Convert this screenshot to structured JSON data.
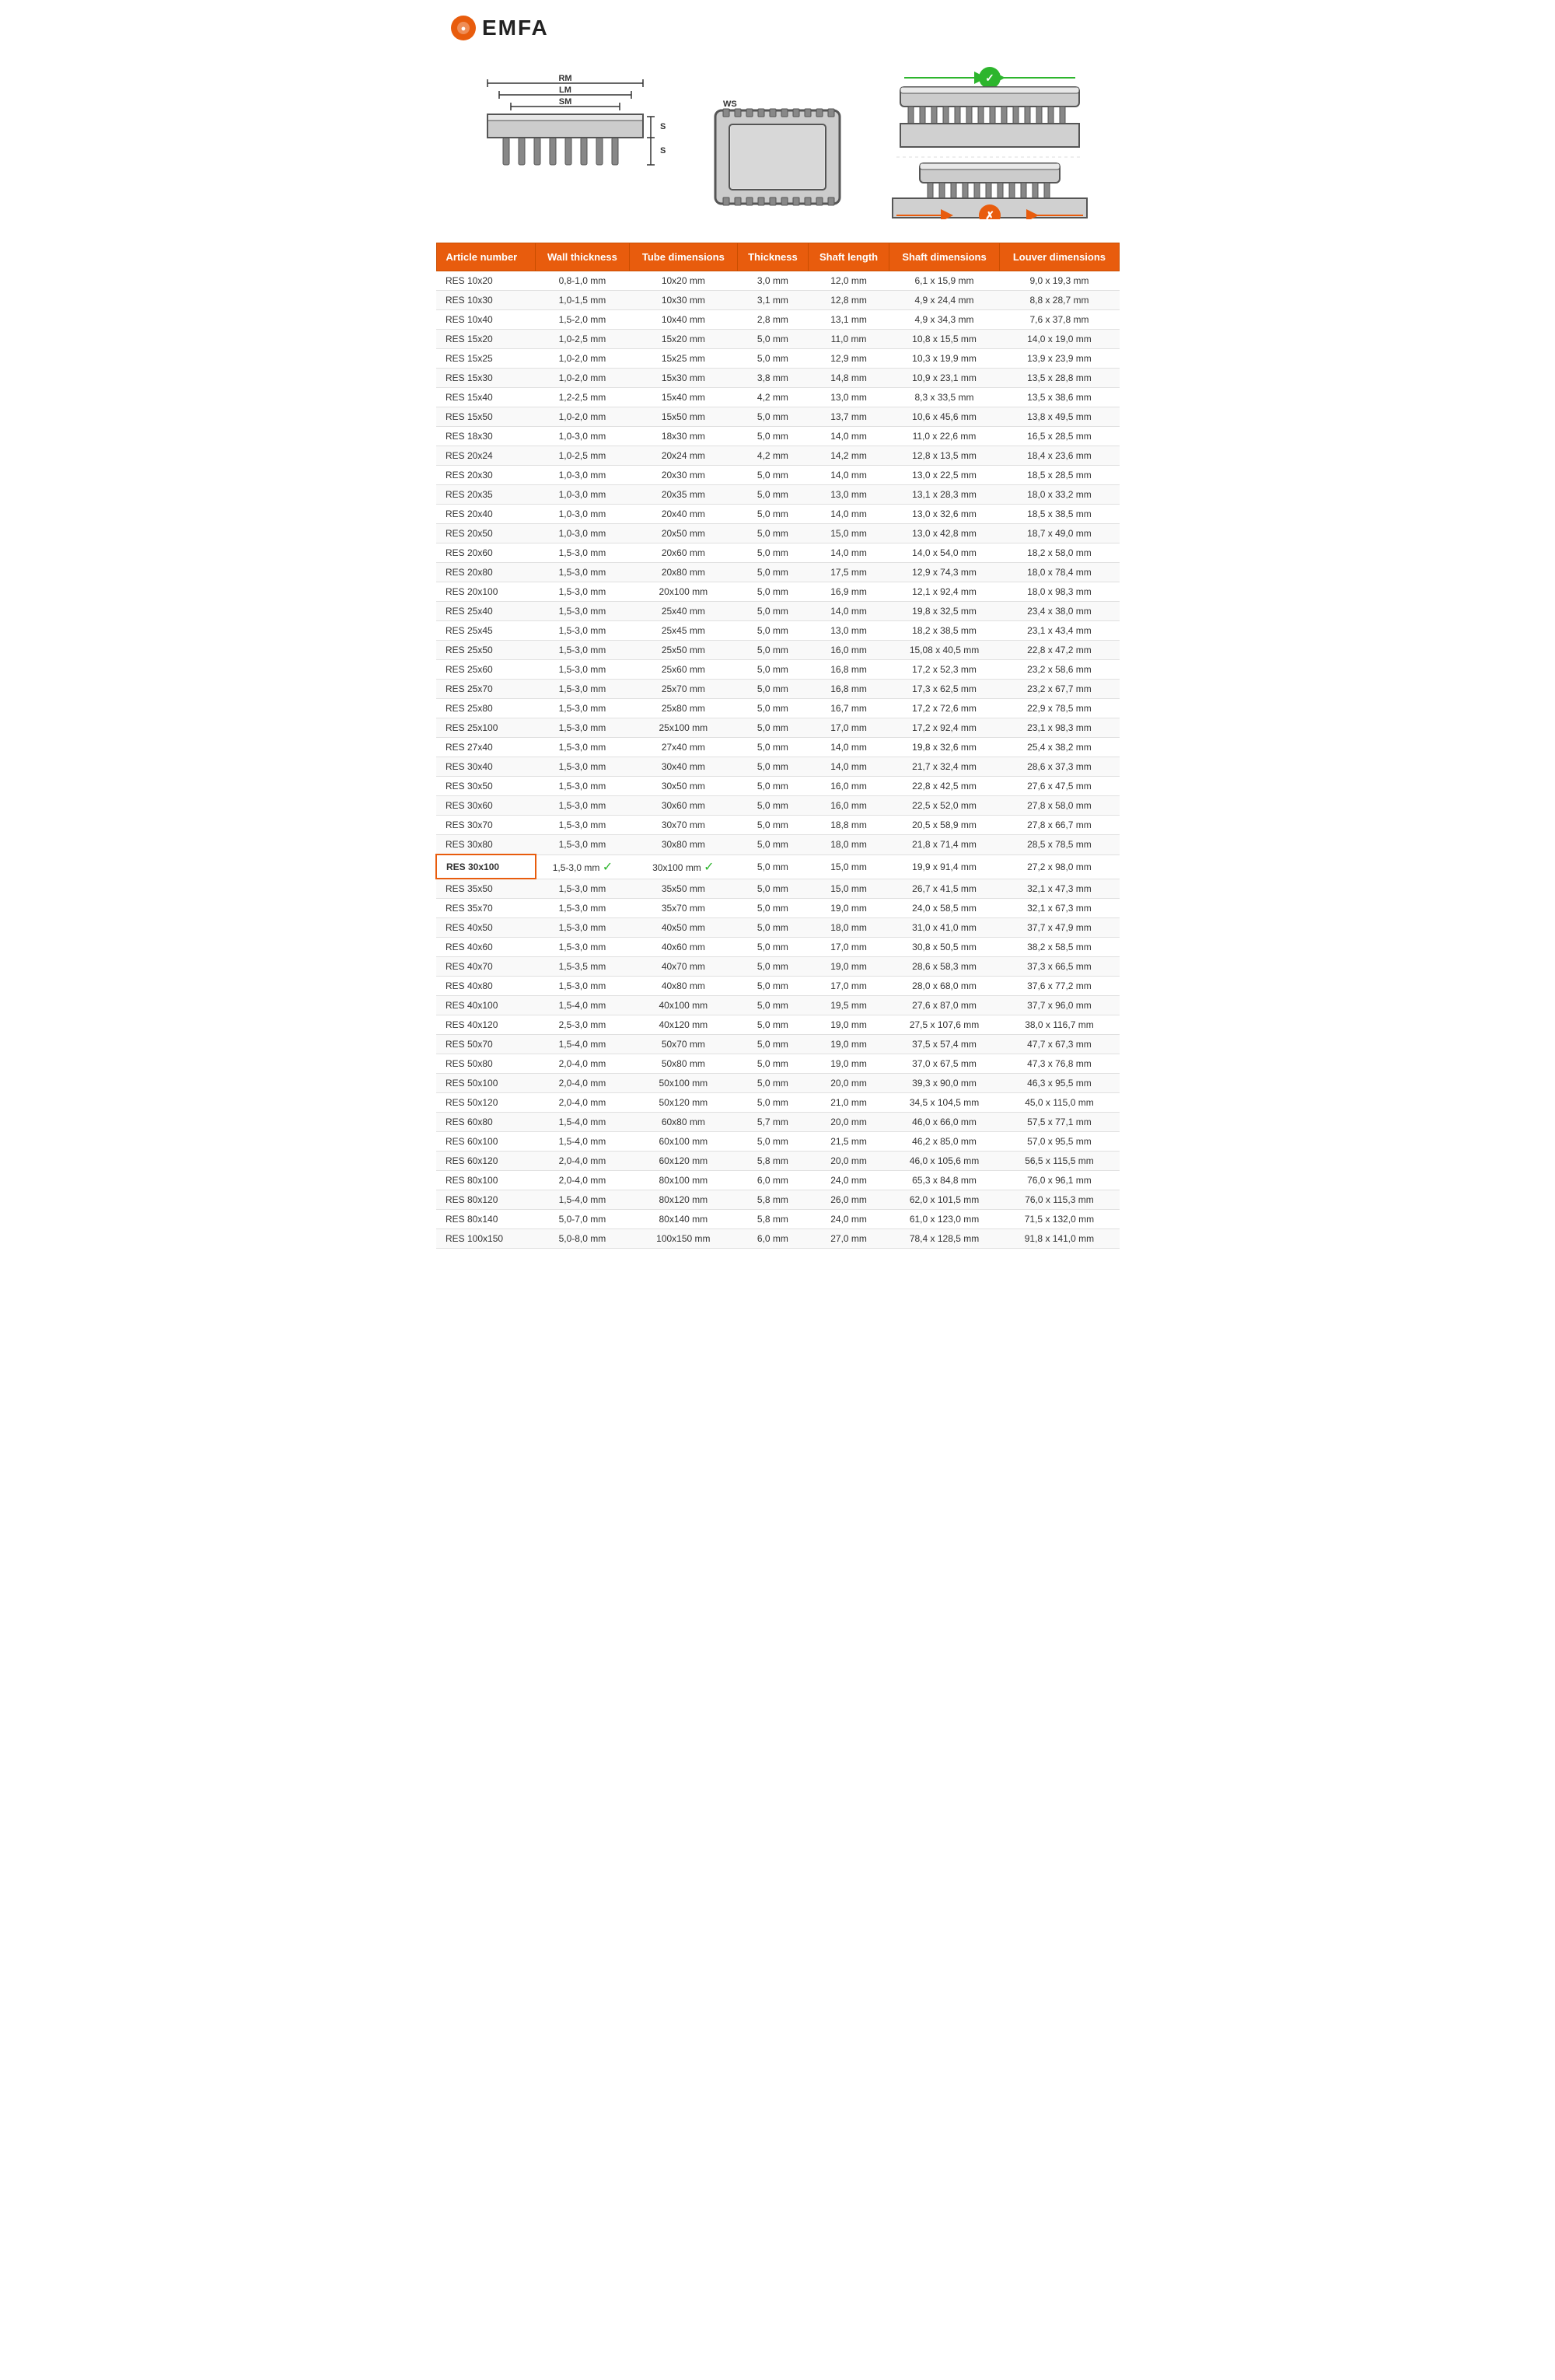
{
  "logo": {
    "brand": "EMFA",
    "icon": "●"
  },
  "diagrams": {
    "diagram1": {
      "labels": [
        "RM",
        "LM",
        "SM",
        "SK",
        "SE"
      ]
    },
    "diagram2": {
      "labels": [
        "WS"
      ]
    },
    "diagram3": {
      "check": "✓",
      "cross": "✗"
    }
  },
  "table": {
    "headers": [
      "Article number",
      "Wall thickness",
      "Tube dimensions",
      "Thickness",
      "Shaft length",
      "Shaft dimensions",
      "Louver dimensions"
    ],
    "rows": [
      [
        "RES 10x20",
        "0,8-1,0 mm",
        "10x20 mm",
        "3,0 mm",
        "12,0 mm",
        "6,1 x 15,9 mm",
        "9,0 x 19,3 mm"
      ],
      [
        "RES 10x30",
        "1,0-1,5 mm",
        "10x30 mm",
        "3,1 mm",
        "12,8 mm",
        "4,9 x 24,4 mm",
        "8,8 x 28,7 mm"
      ],
      [
        "RES 10x40",
        "1,5-2,0 mm",
        "10x40 mm",
        "2,8 mm",
        "13,1 mm",
        "4,9 x 34,3 mm",
        "7,6 x 37,8 mm"
      ],
      [
        "RES 15x20",
        "1,0-2,5 mm",
        "15x20 mm",
        "5,0 mm",
        "11,0 mm",
        "10,8 x 15,5 mm",
        "14,0 x 19,0 mm"
      ],
      [
        "RES 15x25",
        "1,0-2,0 mm",
        "15x25 mm",
        "5,0 mm",
        "12,9 mm",
        "10,3 x 19,9 mm",
        "13,9 x 23,9 mm"
      ],
      [
        "RES 15x30",
        "1,0-2,0 mm",
        "15x30 mm",
        "3,8 mm",
        "14,8 mm",
        "10,9 x 23,1 mm",
        "13,5 x 28,8 mm"
      ],
      [
        "RES 15x40",
        "1,2-2,5 mm",
        "15x40 mm",
        "4,2 mm",
        "13,0 mm",
        "8,3 x 33,5 mm",
        "13,5 x 38,6 mm"
      ],
      [
        "RES 15x50",
        "1,0-2,0 mm",
        "15x50 mm",
        "5,0 mm",
        "13,7 mm",
        "10,6 x 45,6 mm",
        "13,8 x 49,5 mm"
      ],
      [
        "RES 18x30",
        "1,0-3,0 mm",
        "18x30 mm",
        "5,0 mm",
        "14,0 mm",
        "11,0 x 22,6 mm",
        "16,5 x 28,5 mm"
      ],
      [
        "RES 20x24",
        "1,0-2,5 mm",
        "20x24 mm",
        "4,2 mm",
        "14,2 mm",
        "12,8 x 13,5 mm",
        "18,4 x 23,6 mm"
      ],
      [
        "RES 20x30",
        "1,0-3,0 mm",
        "20x30 mm",
        "5,0 mm",
        "14,0 mm",
        "13,0 x 22,5 mm",
        "18,5 x 28,5 mm"
      ],
      [
        "RES 20x35",
        "1,0-3,0 mm",
        "20x35 mm",
        "5,0 mm",
        "13,0 mm",
        "13,1 x 28,3 mm",
        "18,0 x 33,2 mm"
      ],
      [
        "RES 20x40",
        "1,0-3,0 mm",
        "20x40 mm",
        "5,0 mm",
        "14,0 mm",
        "13,0 x 32,6 mm",
        "18,5 x 38,5 mm"
      ],
      [
        "RES 20x50",
        "1,0-3,0 mm",
        "20x50 mm",
        "5,0 mm",
        "15,0 mm",
        "13,0 x 42,8 mm",
        "18,7 x 49,0 mm"
      ],
      [
        "RES 20x60",
        "1,5-3,0 mm",
        "20x60 mm",
        "5,0 mm",
        "14,0 mm",
        "14,0 x 54,0 mm",
        "18,2 x 58,0 mm"
      ],
      [
        "RES 20x80",
        "1,5-3,0 mm",
        "20x80 mm",
        "5,0 mm",
        "17,5 mm",
        "12,9 x 74,3 mm",
        "18,0 x 78,4 mm"
      ],
      [
        "RES 20x100",
        "1,5-3,0 mm",
        "20x100 mm",
        "5,0 mm",
        "16,9 mm",
        "12,1 x 92,4 mm",
        "18,0 x 98,3 mm"
      ],
      [
        "RES 25x40",
        "1,5-3,0 mm",
        "25x40 mm",
        "5,0 mm",
        "14,0 mm",
        "19,8 x 32,5 mm",
        "23,4 x 38,0 mm"
      ],
      [
        "RES 25x45",
        "1,5-3,0 mm",
        "25x45 mm",
        "5,0 mm",
        "13,0 mm",
        "18,2 x 38,5 mm",
        "23,1 x 43,4 mm"
      ],
      [
        "RES 25x50",
        "1,5-3,0 mm",
        "25x50 mm",
        "5,0 mm",
        "16,0 mm",
        "15,08 x 40,5 mm",
        "22,8 x 47,2 mm"
      ],
      [
        "RES 25x60",
        "1,5-3,0 mm",
        "25x60 mm",
        "5,0 mm",
        "16,8 mm",
        "17,2 x 52,3 mm",
        "23,2 x 58,6 mm"
      ],
      [
        "RES 25x70",
        "1,5-3,0 mm",
        "25x70 mm",
        "5,0 mm",
        "16,8 mm",
        "17,3 x 62,5 mm",
        "23,2 x 67,7 mm"
      ],
      [
        "RES 25x80",
        "1,5-3,0 mm",
        "25x80 mm",
        "5,0 mm",
        "16,7 mm",
        "17,2 x 72,6 mm",
        "22,9 x 78,5 mm"
      ],
      [
        "RES 25x100",
        "1,5-3,0 mm",
        "25x100 mm",
        "5,0 mm",
        "17,0 mm",
        "17,2 x 92,4 mm",
        "23,1 x 98,3 mm"
      ],
      [
        "RES 27x40",
        "1,5-3,0 mm",
        "27x40 mm",
        "5,0 mm",
        "14,0 mm",
        "19,8 x 32,6 mm",
        "25,4 x 38,2 mm"
      ],
      [
        "RES 30x40",
        "1,5-3,0 mm",
        "30x40 mm",
        "5,0 mm",
        "14,0 mm",
        "21,7 x 32,4 mm",
        "28,6 x 37,3 mm"
      ],
      [
        "RES 30x50",
        "1,5-3,0 mm",
        "30x50 mm",
        "5,0 mm",
        "16,0 mm",
        "22,8 x 42,5 mm",
        "27,6 x 47,5 mm"
      ],
      [
        "RES 30x60",
        "1,5-3,0 mm",
        "30x60 mm",
        "5,0 mm",
        "16,0 mm",
        "22,5 x 52,0 mm",
        "27,8 x 58,0 mm"
      ],
      [
        "RES 30x70",
        "1,5-3,0 mm",
        "30x70 mm",
        "5,0 mm",
        "18,8 mm",
        "20,5 x 58,9 mm",
        "27,8 x 66,7 mm"
      ],
      [
        "RES 30x80",
        "1,5-3,0 mm",
        "30x80 mm",
        "5,0 mm",
        "18,0 mm",
        "21,8 x 71,4 mm",
        "28,5 x 78,5 mm"
      ],
      [
        "RES 30x100",
        "1,5-3,0 mm",
        "30x100 mm",
        "5,0 mm",
        "15,0 mm",
        "19,9 x 91,4 mm",
        "27,2 x 98,0 mm",
        true
      ],
      [
        "RES 35x50",
        "1,5-3,0 mm",
        "35x50 mm",
        "5,0 mm",
        "15,0 mm",
        "26,7 x 41,5 mm",
        "32,1 x 47,3 mm"
      ],
      [
        "RES 35x70",
        "1,5-3,0 mm",
        "35x70 mm",
        "5,0 mm",
        "19,0 mm",
        "24,0 x 58,5 mm",
        "32,1 x 67,3 mm"
      ],
      [
        "RES 40x50",
        "1,5-3,0 mm",
        "40x50 mm",
        "5,0 mm",
        "18,0 mm",
        "31,0 x 41,0 mm",
        "37,7 x 47,9 mm"
      ],
      [
        "RES 40x60",
        "1,5-3,0 mm",
        "40x60 mm",
        "5,0 mm",
        "17,0 mm",
        "30,8 x 50,5 mm",
        "38,2 x 58,5 mm"
      ],
      [
        "RES 40x70",
        "1,5-3,5 mm",
        "40x70 mm",
        "5,0 mm",
        "19,0 mm",
        "28,6 x 58,3 mm",
        "37,3 x 66,5 mm"
      ],
      [
        "RES 40x80",
        "1,5-3,0 mm",
        "40x80 mm",
        "5,0 mm",
        "17,0 mm",
        "28,0 x 68,0 mm",
        "37,6 x 77,2 mm"
      ],
      [
        "RES 40x100",
        "1,5-4,0 mm",
        "40x100 mm",
        "5,0 mm",
        "19,5 mm",
        "27,6 x 87,0 mm",
        "37,7 x 96,0 mm"
      ],
      [
        "RES 40x120",
        "2,5-3,0 mm",
        "40x120 mm",
        "5,0 mm",
        "19,0 mm",
        "27,5 x 107,6 mm",
        "38,0 x 116,7 mm"
      ],
      [
        "RES 50x70",
        "1,5-4,0 mm",
        "50x70 mm",
        "5,0 mm",
        "19,0 mm",
        "37,5 x 57,4 mm",
        "47,7 x 67,3 mm"
      ],
      [
        "RES 50x80",
        "2,0-4,0 mm",
        "50x80 mm",
        "5,0 mm",
        "19,0 mm",
        "37,0 x 67,5 mm",
        "47,3 x 76,8 mm"
      ],
      [
        "RES 50x100",
        "2,0-4,0 mm",
        "50x100 mm",
        "5,0 mm",
        "20,0 mm",
        "39,3 x 90,0 mm",
        "46,3 x 95,5 mm"
      ],
      [
        "RES 50x120",
        "2,0-4,0 mm",
        "50x120 mm",
        "5,0 mm",
        "21,0 mm",
        "34,5 x 104,5 mm",
        "45,0 x 115,0 mm"
      ],
      [
        "RES 60x80",
        "1,5-4,0 mm",
        "60x80 mm",
        "5,7 mm",
        "20,0 mm",
        "46,0 x 66,0 mm",
        "57,5 x 77,1 mm"
      ],
      [
        "RES 60x100",
        "1,5-4,0 mm",
        "60x100 mm",
        "5,0 mm",
        "21,5 mm",
        "46,2 x 85,0 mm",
        "57,0 x 95,5 mm"
      ],
      [
        "RES 60x120",
        "2,0-4,0 mm",
        "60x120 mm",
        "5,8 mm",
        "20,0 mm",
        "46,0 x 105,6 mm",
        "56,5 x 115,5 mm"
      ],
      [
        "RES 80x100",
        "2,0-4,0 mm",
        "80x100 mm",
        "6,0 mm",
        "24,0 mm",
        "65,3 x 84,8 mm",
        "76,0 x 96,1 mm"
      ],
      [
        "RES 80x120",
        "1,5-4,0 mm",
        "80x120 mm",
        "5,8 mm",
        "26,0 mm",
        "62,0 x 101,5 mm",
        "76,0 x 115,3 mm"
      ],
      [
        "RES 80x140",
        "5,0-7,0 mm",
        "80x140 mm",
        "5,8 mm",
        "24,0 mm",
        "61,0 x 123,0 mm",
        "71,5 x 132,0 mm"
      ],
      [
        "RES 100x150",
        "5,0-8,0 mm",
        "100x150 mm",
        "6,0 mm",
        "27,0 mm",
        "78,4 x 128,5 mm",
        "91,8 x 141,0 mm"
      ]
    ]
  }
}
